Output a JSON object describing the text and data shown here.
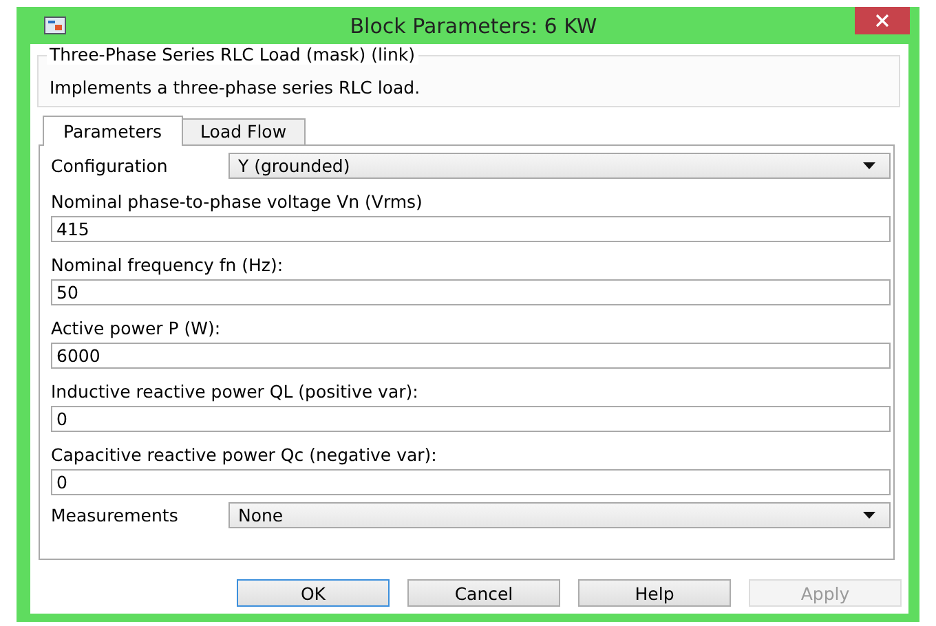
{
  "window": {
    "title": "Block Parameters: 6 KW"
  },
  "mask": {
    "title": "Three-Phase Series RLC Load (mask) (link)",
    "description": "Implements a three-phase series RLC load."
  },
  "tabs": [
    {
      "label": "Parameters",
      "selected": true
    },
    {
      "label": "Load Flow",
      "selected": false
    }
  ],
  "parameters": [
    {
      "kind": "dropdown",
      "label": "Configuration",
      "value": "Y (grounded)"
    },
    {
      "kind": "text",
      "label": "Nominal phase-to-phase voltage Vn (Vrms)",
      "value": "415"
    },
    {
      "kind": "text",
      "label": "Nominal frequency fn (Hz):",
      "value": "50"
    },
    {
      "kind": "text",
      "label": "Active power P (W):",
      "value": "6000"
    },
    {
      "kind": "text",
      "label": "Inductive reactive power QL (positive var):",
      "value": "0"
    },
    {
      "kind": "text",
      "label": "Capacitive reactive power Qc (negative var):",
      "value": "0"
    },
    {
      "kind": "dropdown",
      "label": "Measurements",
      "value": "None"
    }
  ],
  "buttons": [
    {
      "label": "OK",
      "default": true,
      "disabled": false
    },
    {
      "label": "Cancel",
      "default": false,
      "disabled": false
    },
    {
      "label": "Help",
      "default": false,
      "disabled": false
    },
    {
      "label": "Apply",
      "default": false,
      "disabled": true
    }
  ]
}
